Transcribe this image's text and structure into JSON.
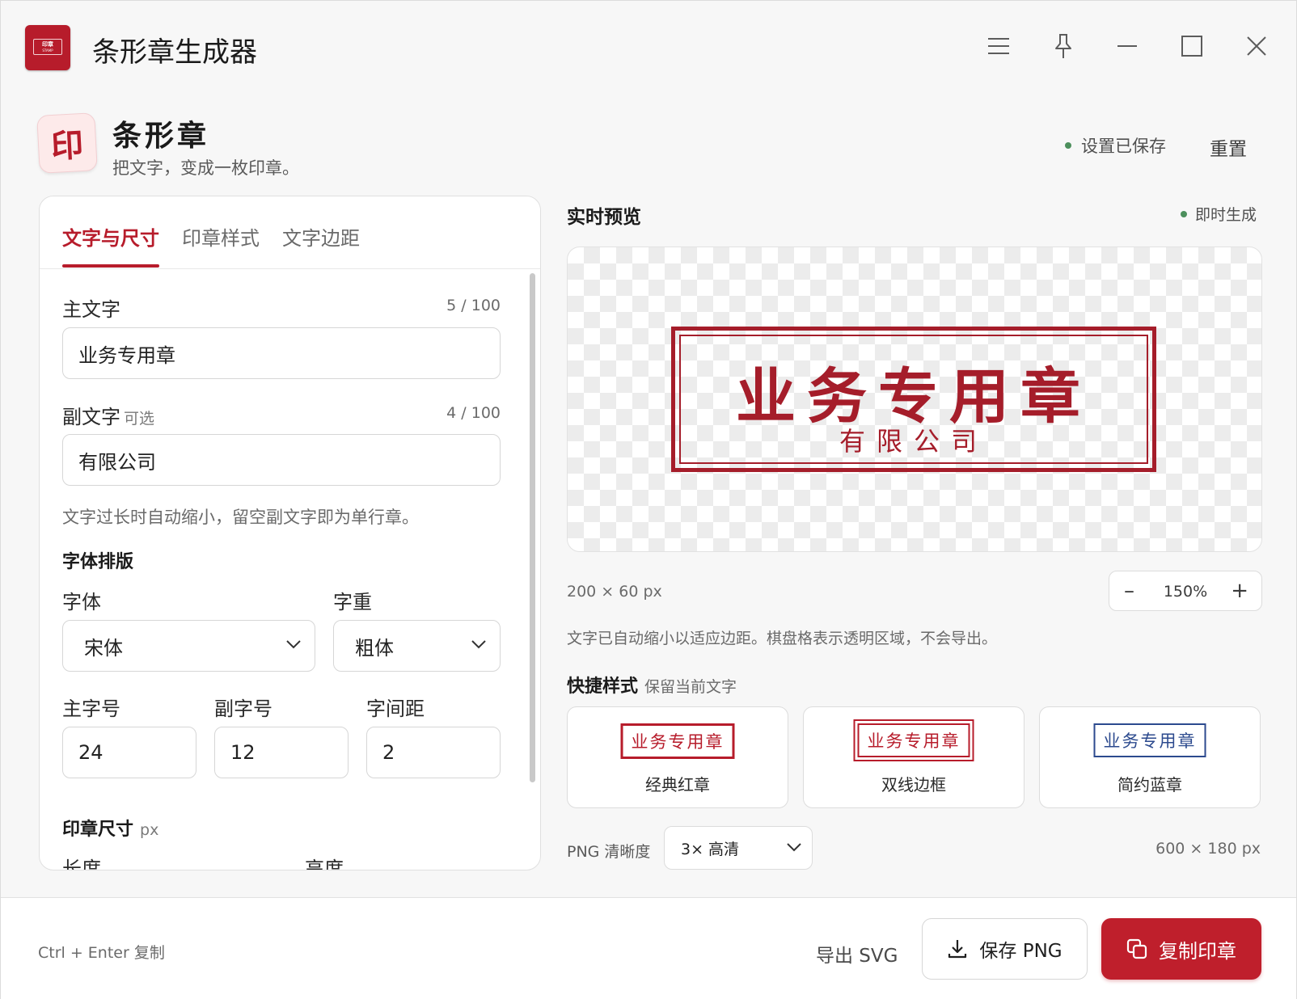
{
  "window": {
    "app_logo_text": "印章",
    "app_logo_sub": "STAMP",
    "title": "条形章生成器"
  },
  "header": {
    "icon_char": "印",
    "title": "条形章",
    "subtitle": "把文字，变成一枚印章。",
    "saved_status": "设置已保存",
    "reset_label": "重置"
  },
  "tabs": [
    {
      "label": "文字与尺寸",
      "active": true
    },
    {
      "label": "印章样式",
      "active": false
    },
    {
      "label": "文字边距",
      "active": false
    }
  ],
  "form": {
    "main_text_label": "主文字",
    "main_text_count": "5 / 100",
    "main_text_value": "业务专用章",
    "sub_text_label": "副文字",
    "sub_text_optional": "可选",
    "sub_text_count": "4 / 100",
    "sub_text_value": "有限公司",
    "hint": "文字过长时自动缩小，留空副文字即为单行章。",
    "typography_section": "字体排版",
    "font_label": "字体",
    "font_value": "宋体",
    "weight_label": "字重",
    "weight_value": "粗体",
    "main_size_label": "主字号",
    "main_size_value": "24",
    "sub_size_label": "副字号",
    "sub_size_value": "12",
    "spacing_label": "字间距",
    "spacing_value": "2",
    "size_section": "印章尺寸",
    "size_unit": "px",
    "length_label": "长度",
    "height_label": "高度"
  },
  "preview": {
    "title": "实时预览",
    "instant": "即时生成",
    "stamp_main": "业务专用章",
    "stamp_sub": "有限公司",
    "dimensions": "200 × 60 px",
    "zoom_minus": "–",
    "zoom_value": "150%",
    "zoom_plus": "+",
    "note": "文字已自动缩小以适应边距。棋盘格表示透明区域，不会导出。",
    "accent_color": "#a51d2a"
  },
  "quick_styles": {
    "title": "快捷样式",
    "subtitle": "保留当前文字",
    "items": [
      {
        "sample": "业务专用章",
        "name": "经典红章"
      },
      {
        "sample": "业务专用章",
        "name": "双线边框"
      },
      {
        "sample": "业务专用章",
        "name": "简约蓝章"
      }
    ]
  },
  "export": {
    "png_label": "PNG 清晰度",
    "png_value": "3× 高清",
    "png_dimensions": "600 × 180 px"
  },
  "footer": {
    "shortcut": "Ctrl + Enter 复制",
    "export_svg": "导出 SVG",
    "save_png": "保存 PNG",
    "copy_stamp": "复制印章",
    "primary_color": "#bf1f2c"
  }
}
